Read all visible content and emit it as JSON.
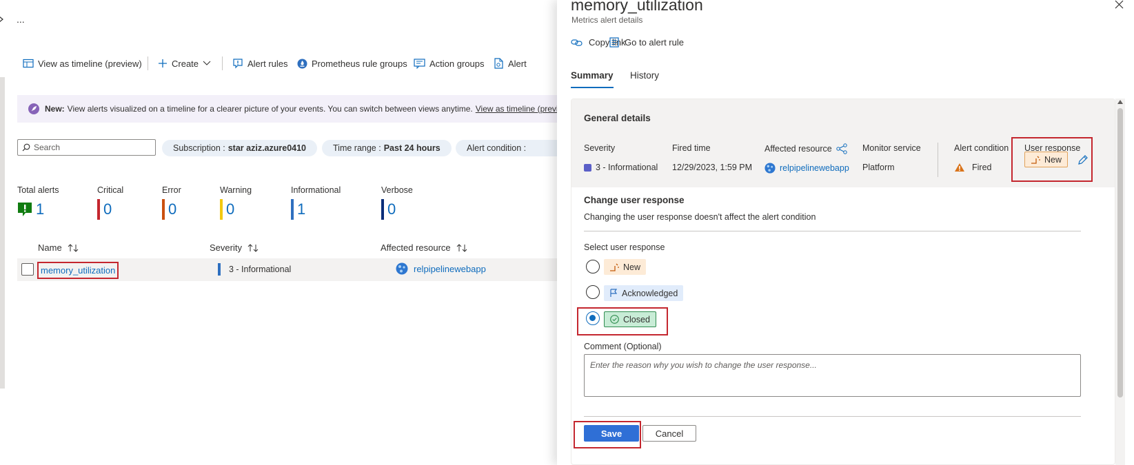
{
  "left": {
    "top_ellipsis": "...",
    "toolbar": {
      "view_timeline": "View as timeline (preview)",
      "create": "Create",
      "alert_rules": "Alert rules",
      "prometheus": "Prometheus rule groups",
      "action_groups": "Action groups",
      "alert_more": "Alert"
    },
    "banner": {
      "new_label": "New:",
      "text": "View alerts visualized on a timeline for a clearer picture of your events. You can switch between views anytime.",
      "link": "View as timeline (previe"
    },
    "search": {
      "placeholder": "Search"
    },
    "filters": [
      {
        "label": "Subscription :",
        "value": "star aziz.azure0410"
      },
      {
        "label": "Time range :",
        "value": "Past 24 hours"
      },
      {
        "label": "Alert condition :",
        "value": ""
      }
    ],
    "stats": [
      {
        "label": "Total alerts",
        "value": "1",
        "color": "#107c10"
      },
      {
        "label": "Critical",
        "value": "0",
        "color": "#c4262e"
      },
      {
        "label": "Error",
        "value": "0",
        "color": "#ca5010"
      },
      {
        "label": "Warning",
        "value": "0",
        "color": "#f2c811"
      },
      {
        "label": "Informational",
        "value": "1",
        "color": "#2e6fbf"
      },
      {
        "label": "Verbose",
        "value": "0",
        "color": "#0b2e7a"
      }
    ],
    "table": {
      "columns": [
        "Name",
        "Severity",
        "Affected resource"
      ],
      "rows": [
        {
          "name": "memory_utilization",
          "severity": "3 - Informational",
          "resource": "relpipelinewebapp"
        }
      ]
    }
  },
  "blade": {
    "title": "memory_utilization",
    "subtitle": "Metrics alert details",
    "commands": {
      "copy_link": "Copy link",
      "go_to_rule": "Go to alert rule"
    },
    "tabs": [
      "Summary",
      "History"
    ],
    "general": {
      "title": "General details",
      "labels": {
        "severity": "Severity",
        "fired_time": "Fired time",
        "affected_resource": "Affected resource",
        "monitor_service": "Monitor service",
        "alert_condition": "Alert condition",
        "user_response": "User response"
      },
      "values": {
        "severity": "3 - Informational",
        "fired_time": "12/29/2023, 1:59 PM",
        "affected_resource": "relpipelinewebapp",
        "monitor_service": "Platform",
        "alert_condition": "Fired",
        "user_response": "New"
      }
    },
    "change": {
      "title": "Change user response",
      "description": "Changing the user response doesn't affect the alert condition",
      "select_label": "Select user response",
      "options": [
        "New",
        "Acknowledged",
        "Closed"
      ],
      "selected": "Closed",
      "comment_label": "Comment (Optional)",
      "comment_placeholder": "Enter the reason why you wish to change the user response..."
    },
    "buttons": {
      "save": "Save",
      "cancel": "Cancel"
    }
  },
  "colors": {
    "accent": "#0f6cbd",
    "highlight": "#c4262e",
    "save_button": "#2f6fd6",
    "new_badge": "#fdebd7",
    "ack_badge": "#e1ecfb",
    "closed_badge": "#c8ecd6"
  }
}
